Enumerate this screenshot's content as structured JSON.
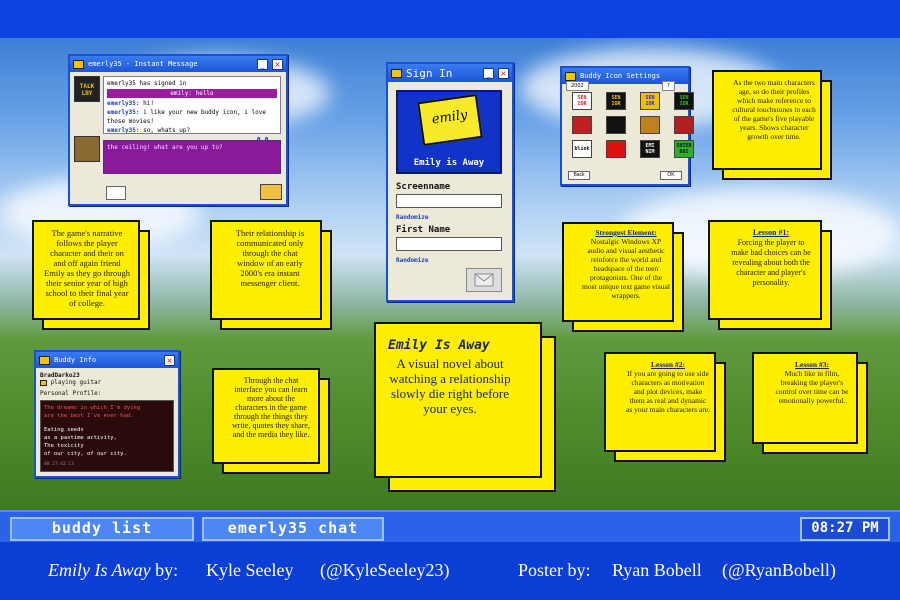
{
  "im_window": {
    "title": "emerly35 - Instant Message",
    "lines": [
      {
        "who": "",
        "text": "emerly35 has signed in"
      },
      {
        "who": "",
        "text": "emily: hello",
        "them": true
      },
      {
        "who": "emerly35:",
        "text": "hi!"
      },
      {
        "who": "emerly35:",
        "text": "i like your new buddy icon, i love those movies!"
      },
      {
        "who": "emerly35:",
        "text": "so, whats up?"
      }
    ],
    "input_text": "the ceiling! what are you up to?",
    "avatar_top_label": "TALK LBY"
  },
  "signin_window": {
    "title": "Sign In",
    "logo_note": "emily",
    "logo_name": "Emily is Away",
    "screenname_label": "Screenname",
    "firstname_label": "First Name",
    "randomize_1": "Randomize",
    "randomize_2": "Randomize"
  },
  "buddy_icon_window": {
    "title": "Buddy Icon Settings",
    "tab_left": "2002",
    "tab_right": "?",
    "icons": [
      {
        "label": "SEN IOR",
        "bg": "#ffffff",
        "fg": "#d91c1c"
      },
      {
        "label": "SEN IOR",
        "bg": "#111111",
        "fg": "#f0c000"
      },
      {
        "label": "SEN IOR",
        "bg": "#f0c000",
        "fg": "#1c2cd9"
      },
      {
        "label": "SEN IOR",
        "bg": "#111111",
        "fg": "#30c030"
      },
      {
        "label": "",
        "bg": "#c02020",
        "fg": "#ffffff"
      },
      {
        "label": "",
        "bg": "#111111",
        "fg": "#ffffff"
      },
      {
        "label": "",
        "bg": "#c08020",
        "fg": "#ffffff"
      },
      {
        "label": "",
        "bg": "#b02020",
        "fg": "#ffffff"
      },
      {
        "label": "blink",
        "bg": "#ffffff",
        "fg": "#111111"
      },
      {
        "label": "",
        "bg": "#e01010",
        "fg": "#ffffff"
      },
      {
        "label": "EMI NIM",
        "bg": "#111111",
        "fg": "#ffffff"
      },
      {
        "label": "SHIER BOI",
        "bg": "#2ab02a",
        "fg": "#111111"
      }
    ],
    "back_label": "Back",
    "ok_label": "OK"
  },
  "buddy_info_window": {
    "title": "Buddy Info",
    "screenname": "BradDarko23",
    "status": "playing guitar",
    "profile_label": "Personal Profile:",
    "profile_lines": [
      "The dreams in which I'm dying",
      "are the best I've ever had.",
      "",
      "Eating seeds",
      "as a pastime activity,",
      "The toxicity",
      "of our city, of our city."
    ],
    "timestamp": "08:27:42:13"
  },
  "notes": {
    "n1": {
      "body": "The game's narrative follows the player character and their on and off again friend Emily as they go through their senior year of high school to their final year of college."
    },
    "n2": {
      "body": "Their relationship is communicated only through the chat window of an early 2000's era instant messenger client."
    },
    "n3": {
      "body": "Through the chat interface you can learn more about the characters in the game through the things they write, quotes they share, and the media they like."
    },
    "n4": {
      "title": "Emily Is Away",
      "body": "A visual novel about watching a relationship slowly die right before your eyes."
    },
    "n5": {
      "body": "As the two main characters age, so do their profiles which make reference to cultural touchstones in each of the game's five playable years. Shows character growth over time."
    },
    "n6": {
      "heading": "Strongest Element:",
      "body": "Nostalgic Windows XP audio and visual aesthetic reinforce the world and headspace of the teen protagonists. One of the most unique text game visual wrappers."
    },
    "n7": {
      "heading": "Lesson #1:",
      "body": "Forcing the player to make bad choices can be revealing about both the character and player's personality."
    },
    "n8": {
      "heading": "Lesson #2:",
      "body": "If you are going to use side characters as motivation and plot devices, make them as real and dynamic as your main characters are."
    },
    "n9": {
      "heading": "Lesson #3:",
      "body": "Much like in film, breaking the player's control over time can be emotionally powerful."
    }
  },
  "taskbar": {
    "tab1": "buddy list",
    "tab2": "emerly35 chat",
    "clock": "08:27 PM"
  },
  "credits": {
    "game_title": "Emily Is Away",
    "by": " by:",
    "author": "Kyle Seeley",
    "author_handle": "(@KyleSeeley23)",
    "poster_by": "Poster by:",
    "poster_author": "Ryan Bobell",
    "poster_handle": "(@RyanBobell)"
  },
  "colors": {
    "accent": "#0b42e0",
    "note_yellow": "#ffee00",
    "im_purple": "#8a1a9c"
  }
}
